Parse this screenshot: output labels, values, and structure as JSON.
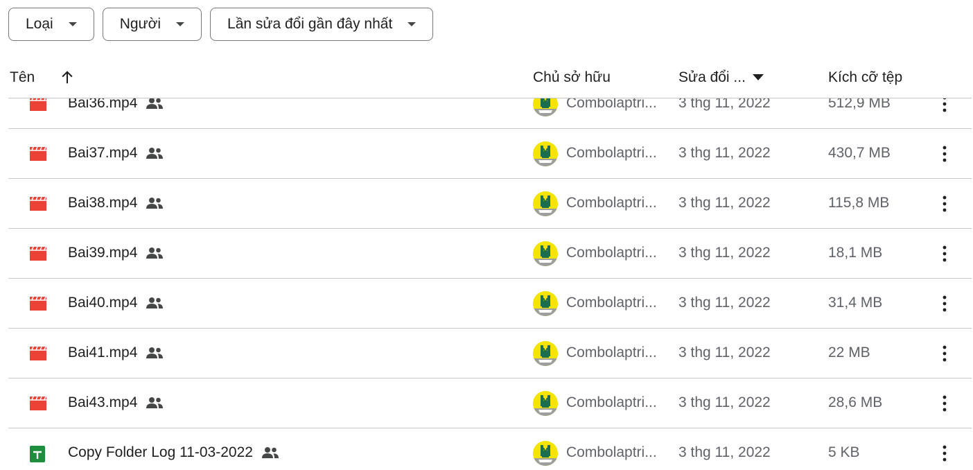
{
  "filters": [
    {
      "label": "Loại"
    },
    {
      "label": "Người"
    },
    {
      "label": "Lần sửa đổi gần đây nhất"
    }
  ],
  "columns": {
    "name": "Tên",
    "owner": "Chủ sở hữu",
    "modified": "Sửa đổi ...",
    "size": "Kích cỡ tệp"
  },
  "colors": {
    "video_icon": "#ea4335",
    "sheets_icon": "#1e8e3e",
    "avatar_bg": "#f5e400",
    "divider": "#c4c7c5",
    "secondary_text": "#5f6368"
  },
  "files": [
    {
      "name": "Bai36.mp4",
      "type": "video",
      "owner": "Combolaptri...",
      "modified": "3 thg 11, 2022",
      "size": "512,9 MB"
    },
    {
      "name": "Bai37.mp4",
      "type": "video",
      "owner": "Combolaptri...",
      "modified": "3 thg 11, 2022",
      "size": "430,7 MB"
    },
    {
      "name": "Bai38.mp4",
      "type": "video",
      "owner": "Combolaptri...",
      "modified": "3 thg 11, 2022",
      "size": "115,8 MB"
    },
    {
      "name": "Bai39.mp4",
      "type": "video",
      "owner": "Combolaptri...",
      "modified": "3 thg 11, 2022",
      "size": "18,1 MB"
    },
    {
      "name": "Bai40.mp4",
      "type": "video",
      "owner": "Combolaptri...",
      "modified": "3 thg 11, 2022",
      "size": "31,4 MB"
    },
    {
      "name": "Bai41.mp4",
      "type": "video",
      "owner": "Combolaptri...",
      "modified": "3 thg 11, 2022",
      "size": "22 MB"
    },
    {
      "name": "Bai43.mp4",
      "type": "video",
      "owner": "Combolaptri...",
      "modified": "3 thg 11, 2022",
      "size": "28,6 MB"
    },
    {
      "name": "Copy Folder Log 11-03-2022",
      "type": "spreadsheet",
      "owner": "Combolaptri...",
      "modified": "3 thg 11, 2022",
      "size": "5 KB"
    }
  ]
}
